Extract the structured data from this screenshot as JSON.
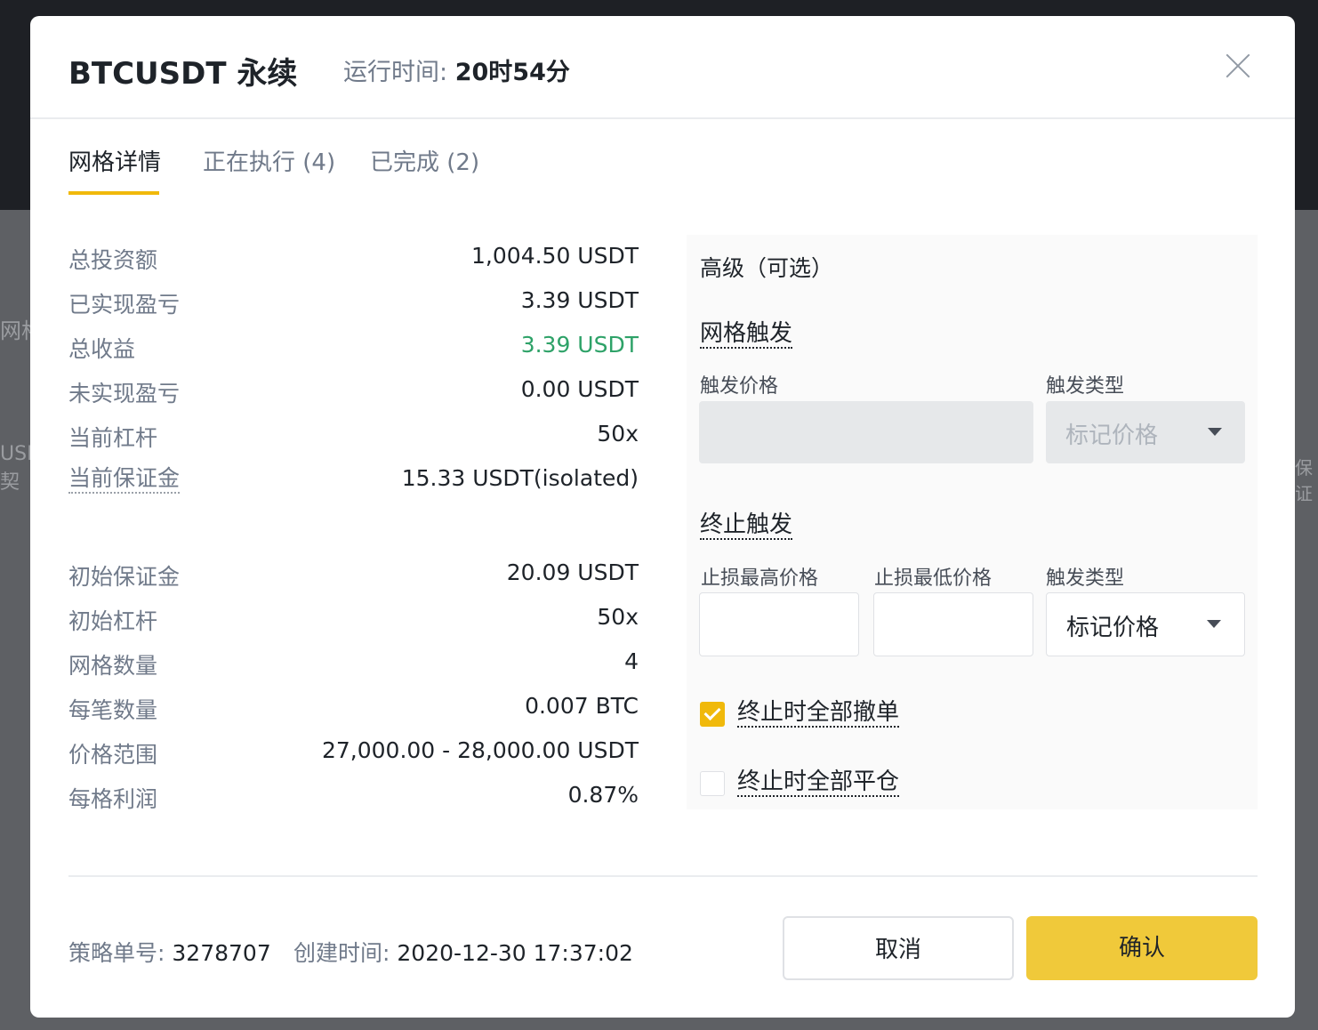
{
  "background": {
    "peek_left_1": "网格",
    "peek_left_2": "USD",
    "peek_left_3": "契",
    "peek_right": "保证"
  },
  "header": {
    "title": "BTCUSDT 永续",
    "runtime_label": "运行时间:",
    "runtime_value": "20时54分",
    "close_icon": "close-icon"
  },
  "tabs": [
    {
      "label": "网格详情",
      "active": true
    },
    {
      "label": "正在执行 (4)",
      "active": false
    },
    {
      "label": "已完成 (2)",
      "active": false
    }
  ],
  "details": [
    {
      "label": "总投资额",
      "value": "1,004.50 USDT"
    },
    {
      "label": "已实现盈亏",
      "value": "3.39 USDT"
    },
    {
      "label": "总收益",
      "value": "3.39 USDT",
      "color": "#2ea268"
    },
    {
      "label": "未实现盈亏",
      "value": "0.00 USDT"
    },
    {
      "label": "当前杠杆",
      "value": "50x"
    },
    {
      "label": "当前保证金",
      "value": "15.33 USDT(isolated)"
    },
    {
      "label": "初始保证金",
      "value": "20.09 USDT"
    },
    {
      "label": "初始杠杆",
      "value": "50x"
    },
    {
      "label": "网格数量",
      "value": "4"
    },
    {
      "label": "每笔数量",
      "value": "0.007 BTC"
    },
    {
      "label": "价格范围",
      "value": "27,000.00 - 28,000.00 USDT"
    },
    {
      "label": "每格利润",
      "value": "0.87%"
    }
  ],
  "advanced": {
    "title": "高级（可选）",
    "grid_trigger": {
      "title": "网格触发",
      "price_label": "触发价格",
      "price_value": "",
      "type_label": "触发类型",
      "type_value": "标记价格"
    },
    "stop_trigger": {
      "title": "终止触发",
      "high_label": "止损最高价格",
      "low_label": "止损最低价格",
      "type_label": "触发类型",
      "type_value": "标记价格"
    },
    "cancel_all": {
      "label": "终止时全部撤单",
      "checked": true
    },
    "close_all": {
      "label": "终止时全部平仓",
      "checked": false
    }
  },
  "footer": {
    "order_label": "策略单号:",
    "order_id": "3278707",
    "created_label": "创建时间:",
    "created_time": "2020-12-30 17:37:02",
    "cancel_button": "取消",
    "confirm_button": "确认"
  },
  "colors": {
    "accent": "#f0b90b",
    "profit_green": "#2ea268"
  }
}
